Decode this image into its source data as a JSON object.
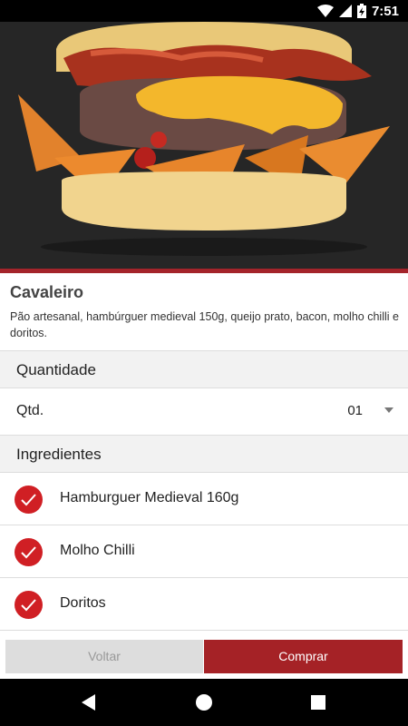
{
  "status_bar": {
    "time": "7:51",
    "icons": [
      "wifi-icon",
      "signal-icon",
      "battery-charging-icon"
    ]
  },
  "hero": {
    "image": "burger-photo",
    "accent_color": "#a4242a"
  },
  "product": {
    "title": "Cavaleiro",
    "description": "Pão artesanal, hambúrguer medieval 150g, queijo prato, bacon, molho chilli e doritos."
  },
  "quantity": {
    "section_title": "Quantidade",
    "label": "Qtd.",
    "value": "01"
  },
  "ingredients": {
    "section_title": "Ingredientes",
    "items": [
      {
        "label": "Hamburguer Medieval 160g",
        "checked": true
      },
      {
        "label": "Molho Chilli",
        "checked": true
      },
      {
        "label": "Doritos",
        "checked": true
      }
    ]
  },
  "actions": {
    "back_label": "Voltar",
    "buy_label": "Comprar"
  },
  "colors": {
    "brand": "#a52226",
    "check": "#d01f24"
  },
  "nav": {
    "icons": [
      "back-icon",
      "home-icon",
      "recents-icon"
    ]
  }
}
